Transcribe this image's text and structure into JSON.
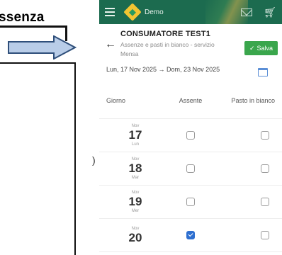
{
  "annotation": {
    "word": "ssenza"
  },
  "stray_glyph": ")",
  "app": {
    "brand": "Demo",
    "icons": [
      "hamburger-menu-icon",
      "brand-logo-icon",
      "mail-icon",
      "cart-icon"
    ],
    "accent_color": "#1c6b4f"
  },
  "header": {
    "title": "CONSUMATORE TEST1",
    "caption": "Assenze e pasti in bianco - servizio Mensa",
    "save_label": "Salva",
    "save_color": "#3aa64c"
  },
  "date_range": "Lun, 17 Nov 2025 → Dom, 23 Nov 2025",
  "table": {
    "columns": {
      "day": "Giorno",
      "absent": "Assente",
      "plain_meal": "Pasto in bianco"
    },
    "rows": [
      {
        "month": "Nov",
        "day": "17",
        "weekday": "Lun",
        "absent": false,
        "plain_meal": false
      },
      {
        "month": "Nov",
        "day": "18",
        "weekday": "Mar",
        "absent": false,
        "plain_meal": false
      },
      {
        "month": "Nov",
        "day": "19",
        "weekday": "Mer",
        "absent": false,
        "plain_meal": false
      },
      {
        "month": "Nov",
        "day": "20",
        "weekday": "",
        "absent": true,
        "plain_meal": false
      }
    ]
  }
}
